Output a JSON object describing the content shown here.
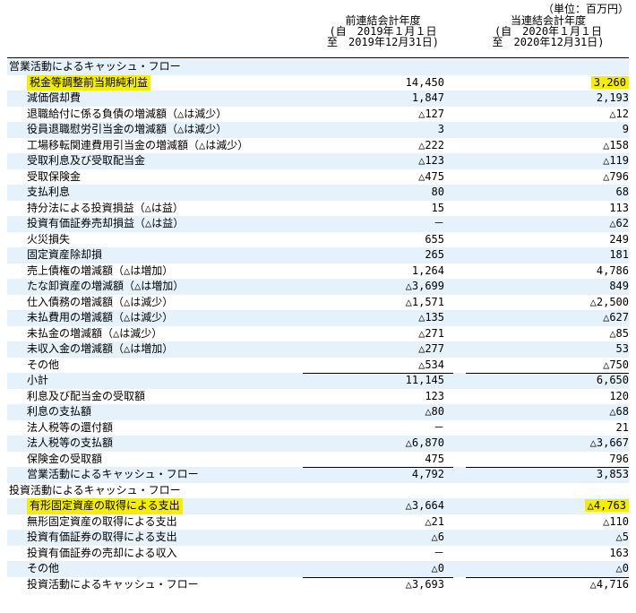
{
  "unit_label": "（単位：百万円）",
  "columns": {
    "prev": {
      "line1": "前連結会計年度",
      "line2": "(自　2019年１月１日",
      "line3": "至　2019年12月31日)"
    },
    "cur": {
      "line1": "当連結会計年度",
      "line2": "(自　2020年１月１日",
      "line3": "至　2020年12月31日)"
    }
  },
  "rows": [
    {
      "label": "営業活動によるキャッシュ・フロー",
      "prev": "",
      "cur": "",
      "type": "section"
    },
    {
      "label": "税金等調整前当期純利益",
      "prev": "14,450",
      "cur": "3,260",
      "highlight_label": true,
      "highlight_cur": true
    },
    {
      "label": "減価償却費",
      "prev": "1,847",
      "cur": "2,193"
    },
    {
      "label": "退職給付に係る負債の増減額（△は減少）",
      "prev": "△127",
      "cur": "△12"
    },
    {
      "label": "役員退職慰労引当金の増減額（△は減少）",
      "prev": "3",
      "cur": "9"
    },
    {
      "label": "工場移転関連費用引当金の増減額（△は減少）",
      "prev": "△222",
      "cur": "△158"
    },
    {
      "label": "受取利息及び受取配当金",
      "prev": "△123",
      "cur": "△119"
    },
    {
      "label": "受取保険金",
      "prev": "△475",
      "cur": "△796"
    },
    {
      "label": "支払利息",
      "prev": "80",
      "cur": "68"
    },
    {
      "label": "持分法による投資損益（△は益）",
      "prev": "15",
      "cur": "113"
    },
    {
      "label": "投資有価証券売却損益（△は益）",
      "prev": "－",
      "cur": "△62"
    },
    {
      "label": "火災損失",
      "prev": "655",
      "cur": "249"
    },
    {
      "label": "固定資産除却損",
      "prev": "265",
      "cur": "181"
    },
    {
      "label": "売上債権の増減額（△は増加）",
      "prev": "1,264",
      "cur": "4,786"
    },
    {
      "label": "たな卸資産の増減額（△は増加）",
      "prev": "△3,699",
      "cur": "849"
    },
    {
      "label": "仕入債務の増減額（△は減少）",
      "prev": "△1,571",
      "cur": "△2,500"
    },
    {
      "label": "未払費用の増減額（△は減少）",
      "prev": "△135",
      "cur": "△627"
    },
    {
      "label": "未払金の増減額（△は減少）",
      "prev": "△271",
      "cur": "△85"
    },
    {
      "label": "未収入金の増減額（△は増加）",
      "prev": "△277",
      "cur": "53"
    },
    {
      "label": "その他",
      "prev": "△534",
      "cur": "△750"
    },
    {
      "label": "小計",
      "prev": "11,145",
      "cur": "6,650",
      "rule": true
    },
    {
      "label": "利息及び配当金の受取額",
      "prev": "123",
      "cur": "120"
    },
    {
      "label": "利息の支払額",
      "prev": "△80",
      "cur": "△68"
    },
    {
      "label": "法人税等の還付額",
      "prev": "－",
      "cur": "21"
    },
    {
      "label": "法人税等の支払額",
      "prev": "△6,870",
      "cur": "△3,667"
    },
    {
      "label": "保険金の受取額",
      "prev": "475",
      "cur": "796"
    },
    {
      "label": "営業活動によるキャッシュ・フロー",
      "prev": "4,792",
      "cur": "3,853",
      "rule": true
    },
    {
      "label": "投資活動によるキャッシュ・フロー",
      "prev": "",
      "cur": "",
      "type": "section"
    },
    {
      "label": "有形固定資産の取得による支出",
      "prev": "△3,664",
      "cur": "△4,763",
      "highlight_label": true,
      "highlight_cur": true
    },
    {
      "label": "無形固定資産の取得による支出",
      "prev": "△21",
      "cur": "△110"
    },
    {
      "label": "投資有価証券の取得による支出",
      "prev": "△6",
      "cur": "△5"
    },
    {
      "label": "投資有価証券の売却による収入",
      "prev": "－",
      "cur": "163"
    },
    {
      "label": "その他",
      "prev": "△0",
      "cur": "△0"
    },
    {
      "label": "投資活動によるキャッシュ・フロー",
      "prev": "△3,693",
      "cur": "△4,716",
      "rule": true
    }
  ],
  "colors": {
    "row_shading": "#e6f2fb",
    "highlight": "#f5ee00"
  }
}
